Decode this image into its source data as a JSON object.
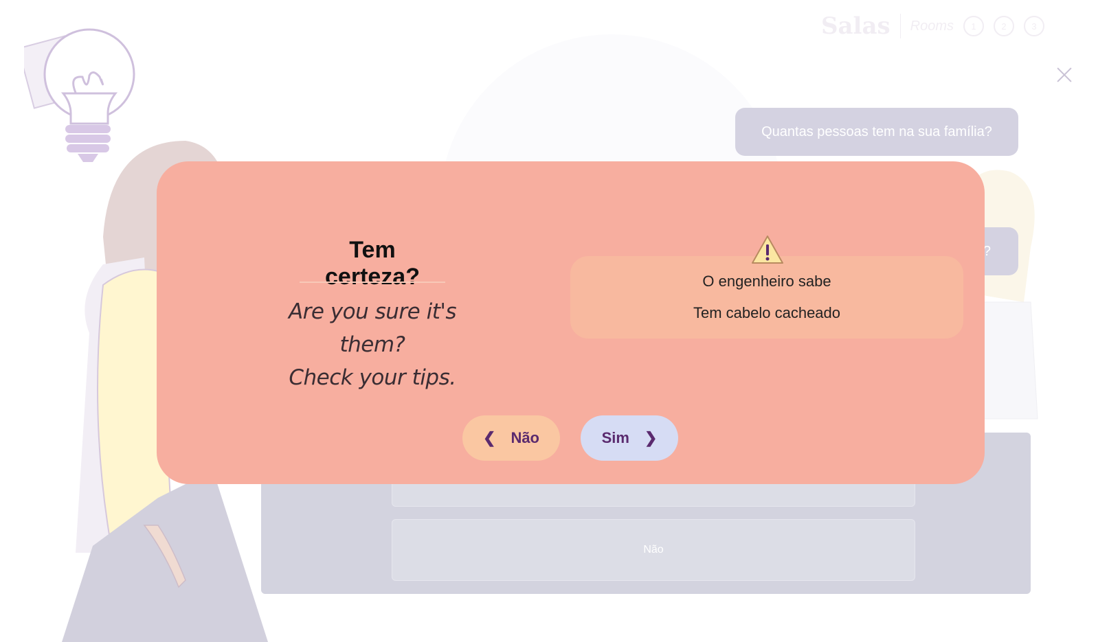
{
  "header": {
    "brand": "Salas",
    "rooms_label": "Rooms",
    "room_numbers": [
      "1",
      "2",
      "3"
    ]
  },
  "background": {
    "question": "Quantas pessoas tem na sua família?",
    "question_partial": "?",
    "answer_no": "Não"
  },
  "modal": {
    "title": "Tem certeza?",
    "subtitle_line1": "Are you sure it's them?",
    "subtitle_line2": "Check your tips.",
    "tips": [
      "O engenheiro sabe",
      "Tem cabelo cacheado"
    ],
    "no_label": "Não",
    "yes_label": "Sim"
  },
  "colors": {
    "modal_bg": "#f7ae9f",
    "tips_bg": "#f8b99f",
    "no_button": "#fac7a2",
    "yes_button": "#d6dcf4",
    "accent_text": "#5a2a6e"
  },
  "icons": [
    "lightbulb-illustration",
    "person-illustration",
    "close-icon",
    "warning-icon",
    "chevron-left-icon",
    "chevron-right-icon"
  ]
}
